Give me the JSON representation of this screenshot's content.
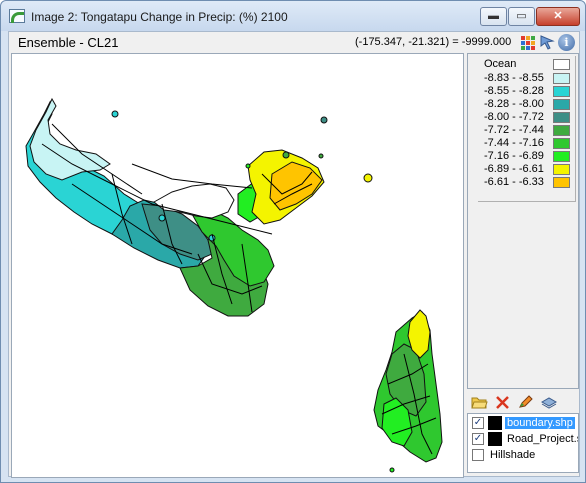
{
  "window": {
    "title": "Image 2: Tongatapu Change in Precip: (%) 2100",
    "min_label": "▬",
    "max_label": "▭",
    "close_label": "✕"
  },
  "infobar": {
    "ensemble": "Ensemble - CL21",
    "coords": "(-175.347, -21.321) = -9999.000"
  },
  "legend": {
    "title": "Ocean",
    "ocean_color": "#ffffff",
    "items": [
      {
        "label": "-8.83 - -8.55",
        "color": "#c8f4f4"
      },
      {
        "label": "-8.55 - -8.28",
        "color": "#2ad4d4"
      },
      {
        "label": "-8.28 - -8.00",
        "color": "#2aa8a8"
      },
      {
        "label": "-8.00 - -7.72",
        "color": "#3e8f86"
      },
      {
        "label": "-7.72 - -7.44",
        "color": "#3faa3f"
      },
      {
        "label": "-7.44 - -7.16",
        "color": "#2fc82f"
      },
      {
        "label": "-7.16 - -6.89",
        "color": "#22ee22"
      },
      {
        "label": "-6.89 - -6.61",
        "color": "#f4f400"
      },
      {
        "label": "-6.61 - -6.33",
        "color": "#ffc400"
      }
    ]
  },
  "layers": [
    {
      "name": "boundary.shp",
      "checked": true,
      "selected": true,
      "swatch": true
    },
    {
      "name": "Road_Project.sl",
      "checked": true,
      "selected": false,
      "swatch": true
    },
    {
      "name": "Hillshade",
      "checked": false,
      "selected": false,
      "swatch": false
    }
  ],
  "icons": {
    "toolbar": [
      "color-grid-icon",
      "arrow-cursor-icon",
      "info-icon"
    ],
    "layer_toolbar": [
      "open-folder-icon",
      "delete-icon",
      "edit-pencil-icon",
      "layer-properties-icon"
    ]
  }
}
